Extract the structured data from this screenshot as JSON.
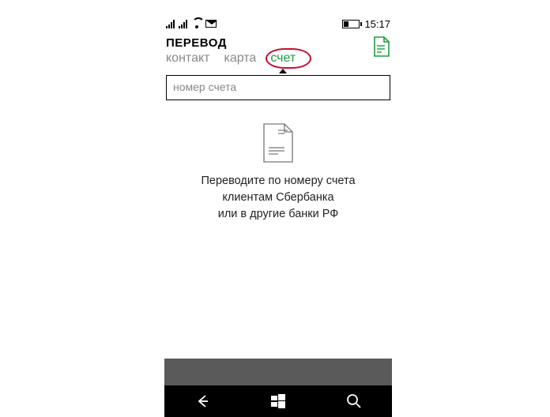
{
  "status": {
    "time": "15:17"
  },
  "header": {
    "title": "ПЕРЕВОД"
  },
  "tabs": {
    "contact": "контакт",
    "card": "карта",
    "account": "счет"
  },
  "input": {
    "placeholder": "номер счета"
  },
  "empty": {
    "line1": "Переводите по номеру счета",
    "line2": "клиентам Сбербанка",
    "line3": "или в другие банки РФ"
  }
}
